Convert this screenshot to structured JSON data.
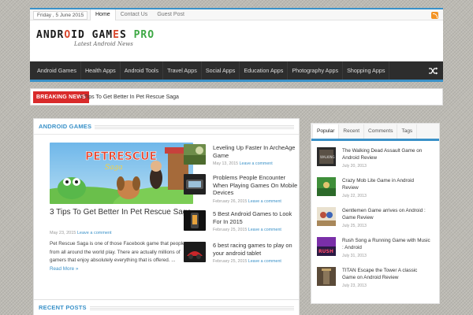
{
  "topbar": {
    "date": "Friday , 5 June 2015",
    "nav": [
      "Home",
      "Contact Us",
      "Guest Post"
    ],
    "active": "Home"
  },
  "logo": {
    "main_1": "ANDR",
    "main_2": "O",
    "main_3": "ID GAM",
    "main_4": "E",
    "main_5": "S ",
    "main_6": "PRO",
    "tagline": "Latest Android News"
  },
  "mainnav": {
    "items": [
      "Android Games",
      "Health Apps",
      "Android Tools",
      "Travel Apps",
      "Social Apps",
      "Education Apps",
      "Photography Apps",
      "Shopping Apps"
    ],
    "shuffle_icon": "shuffle-icon"
  },
  "breaking": {
    "label": "BREAKING NEWS",
    "headline": "3 Tips To Get Better In Pet Rescue Saga"
  },
  "android_games": {
    "heading": "ANDROID GAMES",
    "featured": {
      "title": "3 Tips To Get Better In Pet Rescue Saga",
      "date": "May 23, 2015",
      "comment": "Leave a comment",
      "excerpt": "Pet Rescue Saga is one of those Facebook game that people from all around the world play. There are actually millions of gamers that enjoy absolutely everything that is offered. ...",
      "read_more": "Read More »",
      "image_text": "PETRESCUE"
    },
    "list": [
      {
        "title": "Leveling Up Faster In ArcheAge Game",
        "date": "May 13, 2015",
        "comment": "Leave a comment"
      },
      {
        "title": "Problems People Encounter When Playing Games On Mobile Devices",
        "date": "February 26, 2015",
        "comment": "Leave a comment"
      },
      {
        "title": "5 Best Android Games to Look For In 2015",
        "date": "February 25, 2015",
        "comment": "Leave a comment"
      },
      {
        "title": "6 best racing games to play on your android tablet",
        "date": "February 25, 2015",
        "comment": "Leave a comment"
      }
    ]
  },
  "recent_posts": {
    "heading": "RECENT POSTS"
  },
  "sidebar": {
    "tabs": [
      "Popular",
      "Recent",
      "Comments",
      "Tags"
    ],
    "active_tab": "Popular",
    "items": [
      {
        "title": "The Walking Dead Assault Game on Android Review",
        "date": "July 20, 2013"
      },
      {
        "title": "Crazy Mob Lite Game in Android Review",
        "date": "July 22, 2013"
      },
      {
        "title": "Gentlemen Game arrives on Android : Game Review",
        "date": "July 25, 2013"
      },
      {
        "title": "Rush Song a Running Game with Music : Android",
        "date": "July 31, 2013"
      },
      {
        "title": "TITAN Escape the Tower A classic Game on Android Review",
        "date": "July 23, 2013"
      }
    ]
  },
  "colors": {
    "accent": "#3a91c8",
    "breaking": "#d92b2b",
    "nav_bg": "#2d2d2d"
  }
}
